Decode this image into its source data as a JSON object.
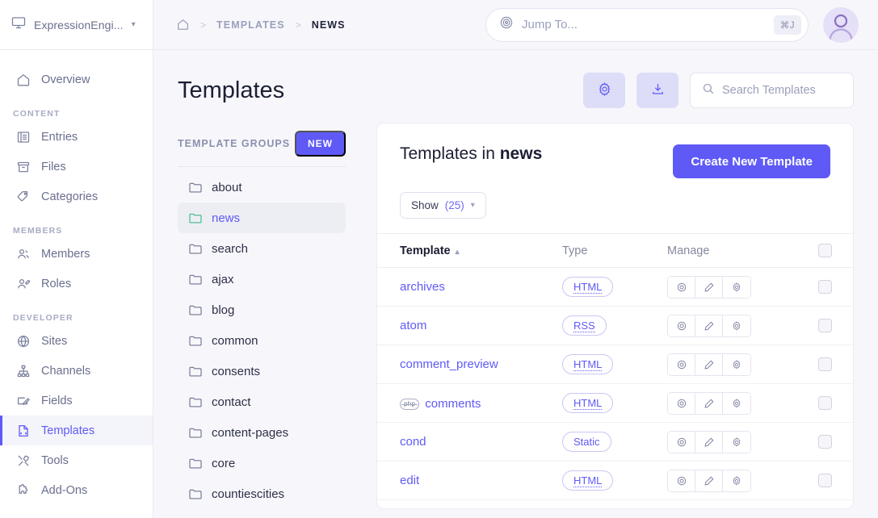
{
  "sidebar": {
    "site_name": "ExpressionEngi...",
    "site_icon": "monitor-icon",
    "items": [
      {
        "label": "Overview",
        "icon": "home-icon"
      }
    ],
    "sections": [
      {
        "title": "CONTENT",
        "items": [
          {
            "label": "Entries",
            "icon": "entries-icon"
          },
          {
            "label": "Files",
            "icon": "files-icon"
          },
          {
            "label": "Categories",
            "icon": "tag-icon"
          }
        ]
      },
      {
        "title": "MEMBERS",
        "items": [
          {
            "label": "Members",
            "icon": "members-icon"
          },
          {
            "label": "Roles",
            "icon": "role-icon"
          }
        ]
      },
      {
        "title": "DEVELOPER",
        "items": [
          {
            "label": "Sites",
            "icon": "globe-icon"
          },
          {
            "label": "Channels",
            "icon": "sitemap-icon"
          },
          {
            "label": "Fields",
            "icon": "field-edit-icon"
          },
          {
            "label": "Templates",
            "icon": "template-file-icon",
            "active": true
          },
          {
            "label": "Tools",
            "icon": "tools-icon"
          },
          {
            "label": "Add-Ons",
            "icon": "puzzle-icon"
          }
        ]
      }
    ]
  },
  "topbar": {
    "home_icon": "home-icon",
    "breadcrumbs": [
      {
        "label": "TEMPLATES",
        "current": false
      },
      {
        "label": "NEWS",
        "current": true
      }
    ],
    "separator": ">",
    "jump_to": {
      "icon": "target-icon",
      "placeholder": "Jump To...",
      "shortcut": "⌘J"
    },
    "avatar": "user-avatar"
  },
  "page": {
    "title": "Templates",
    "actions": [
      {
        "name": "settings",
        "icon": "gear-icon"
      },
      {
        "name": "export",
        "icon": "download-icon"
      }
    ],
    "search": {
      "icon": "search-icon",
      "placeholder": "Search Templates"
    }
  },
  "template_groups": {
    "title": "TEMPLATE GROUPS",
    "new_label": "NEW",
    "items": [
      {
        "label": "about",
        "active": false
      },
      {
        "label": "news",
        "active": true
      },
      {
        "label": "search",
        "active": false
      },
      {
        "label": "ajax",
        "active": false
      },
      {
        "label": "blog",
        "active": false
      },
      {
        "label": "common",
        "active": false
      },
      {
        "label": "consents",
        "active": false
      },
      {
        "label": "contact",
        "active": false
      },
      {
        "label": "content-pages",
        "active": false
      },
      {
        "label": "core",
        "active": false
      },
      {
        "label": "countiescities",
        "active": false
      }
    ]
  },
  "templates_card": {
    "title_prefix": "Templates in ",
    "group_name": "news",
    "create_button": "Create New Template",
    "show_label": "Show",
    "show_count": "(25)",
    "columns": {
      "template": "Template",
      "type": "Type",
      "manage": "Manage"
    },
    "sort_indicator": "⌃",
    "manage_actions": [
      {
        "name": "view",
        "icon": "eye-icon"
      },
      {
        "name": "edit",
        "icon": "pencil-icon"
      },
      {
        "name": "settings",
        "icon": "gear-icon"
      }
    ],
    "rows": [
      {
        "name": "archives",
        "type": "HTML",
        "type_dotted": true,
        "php": false
      },
      {
        "name": "atom",
        "type": "RSS",
        "type_dotted": true,
        "php": false
      },
      {
        "name": "comment_preview",
        "type": "HTML",
        "type_dotted": true,
        "php": false
      },
      {
        "name": "comments",
        "type": "HTML",
        "type_dotted": true,
        "php": true,
        "php_label": "php"
      },
      {
        "name": "cond",
        "type": "Static",
        "type_dotted": false,
        "php": false
      },
      {
        "name": "edit",
        "type": "HTML",
        "type_dotted": true,
        "php": false
      }
    ]
  },
  "colors": {
    "accent": "#5f5af6",
    "accent_soft": "#ddddf8",
    "page_bg": "#f7f7fb",
    "text_dark": "#1b1e33",
    "text_muted": "#84899f",
    "folder_active": "#3fb984"
  }
}
